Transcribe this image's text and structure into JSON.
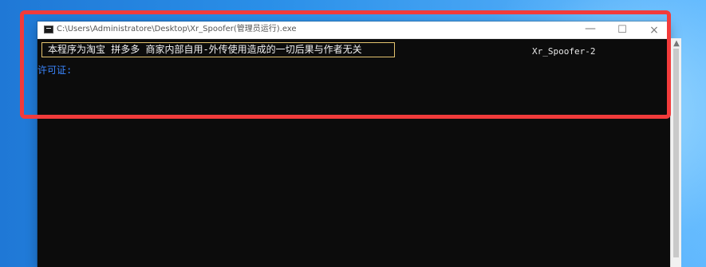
{
  "window": {
    "title": "C:\\Users\\Administratore\\Desktop\\Xr_Spoofer(管理员运行).exe",
    "controls": {
      "minimize": "—",
      "maximize": "☐",
      "close": "×"
    }
  },
  "console": {
    "notice": "本程序为淘宝 拼多多 商家内部自用-外传使用造成的一切后果与作者无关",
    "program_name": "Xr_Spoofer-2",
    "license_label": "许可证:"
  },
  "scrollbar": {
    "up_arrow": "▲"
  },
  "colors": {
    "highlight": "#f23b3b",
    "notice_border": "#e5c46f",
    "license_text": "#3a86ff",
    "console_background": "#0c0c0c"
  },
  "icons": {
    "console": "command-prompt-icon",
    "minimize": "minimize-icon",
    "maximize": "maximize-icon",
    "close": "close-icon",
    "scroll_up": "scroll-up-arrow-icon"
  }
}
